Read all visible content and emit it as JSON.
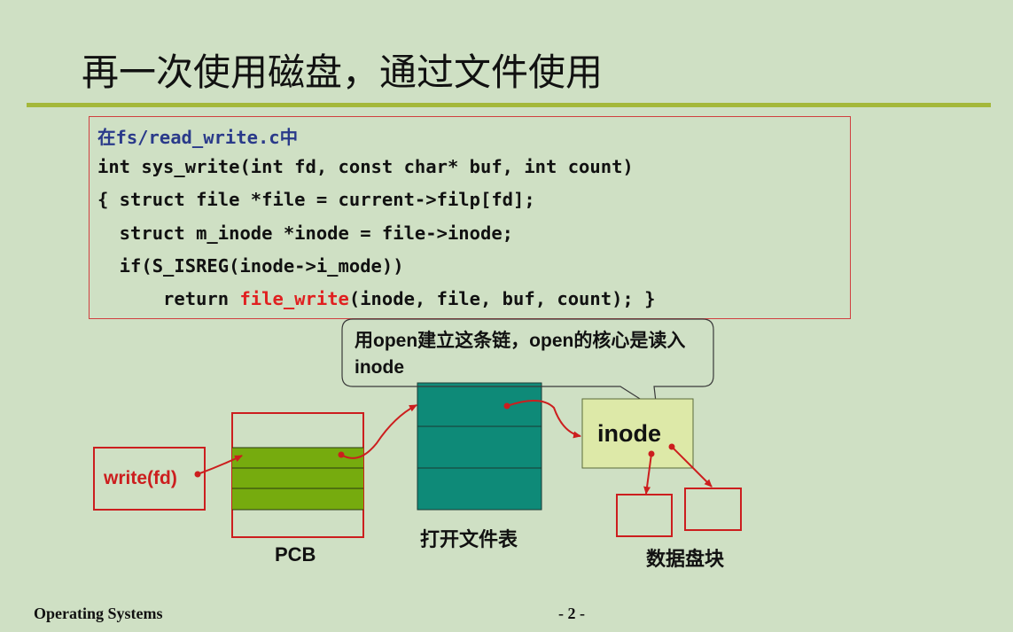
{
  "slide": {
    "title": "再一次使用磁盘，通过文件使用"
  },
  "code": {
    "file_line": "在fs/read_write.c中",
    "lines": [
      "int sys_write(int fd, const char* buf, int count)",
      "{ struct file *file = current->filp[fd];",
      "  struct m_inode *inode = file->inode;",
      "  if(S_ISREG(inode->i_mode))"
    ],
    "return_prefix": "      return ",
    "return_highlight": "file_write",
    "return_suffix": "(inode, file, buf, count); }"
  },
  "callout": {
    "text": "用open建立这条链，open的核心是读入inode"
  },
  "diagram": {
    "write_label": "write(fd)",
    "pcb_label": "PCB",
    "open_file_table_label": "打开文件表",
    "inode_label": "inode",
    "data_blocks_label": "数据盘块"
  },
  "footer": {
    "course": "Operating Systems",
    "page": "- 2 -"
  },
  "colors": {
    "background": "#cfe0c4",
    "rule": "#a4b83a",
    "red": "#cc1e1e",
    "pcb_fill": "#76ab0e",
    "table_fill": "#0e8a78",
    "inode_fill": "#dde9a8"
  }
}
